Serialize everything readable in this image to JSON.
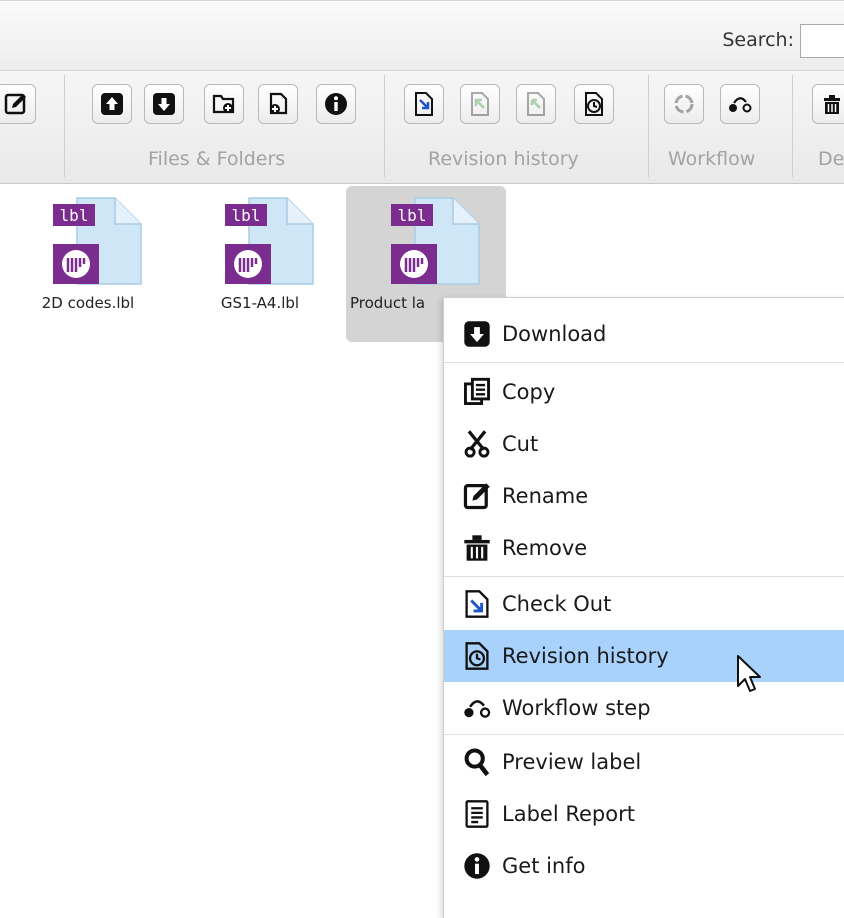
{
  "search": {
    "label": "Search:",
    "value": ""
  },
  "ribbon": {
    "groups": [
      {
        "label": "Files & Folders"
      },
      {
        "label": "Revision history"
      },
      {
        "label": "Workflow"
      },
      {
        "label": "De"
      }
    ]
  },
  "files": [
    {
      "name": "2D codes.lbl",
      "badge": "lbl"
    },
    {
      "name": "GS1-A4.lbl",
      "badge": "lbl"
    },
    {
      "name": "Product l….lbl",
      "visible_name": "Product la",
      "badge": "lbl"
    }
  ],
  "context_menu": {
    "items": [
      {
        "label": "Download",
        "icon": "download-icon"
      },
      {
        "label": "Copy",
        "icon": "copy-icon"
      },
      {
        "label": "Cut",
        "icon": "cut-icon"
      },
      {
        "label": "Rename",
        "icon": "rename-icon"
      },
      {
        "label": "Remove",
        "icon": "trash-icon"
      },
      {
        "label": "Check Out",
        "icon": "check-out-icon"
      },
      {
        "label": "Revision history",
        "icon": "revision-history-icon",
        "highlighted": true
      },
      {
        "label": "Workflow step",
        "icon": "workflow-icon"
      },
      {
        "label": "Preview label",
        "icon": "magnifier-icon"
      },
      {
        "label": "Label Report",
        "icon": "report-icon"
      },
      {
        "label": "Get info",
        "icon": "info-icon"
      }
    ]
  },
  "colors": {
    "highlight": "#a8d1fb",
    "label_purple": "#7b2c8f",
    "file_blue": "#cfe6f7"
  }
}
